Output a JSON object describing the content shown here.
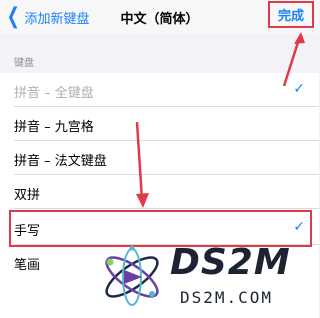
{
  "nav": {
    "back_label": "添加新键盘",
    "title": "中文（简体）",
    "done_label": "完成"
  },
  "section": {
    "header": "键盘"
  },
  "rows": [
    {
      "label": "拼音 – 全键盘",
      "checked": true,
      "disabled": true
    },
    {
      "label": "拼音 – 九宫格",
      "checked": false,
      "disabled": false
    },
    {
      "label": "拼音 – 法文键盘",
      "checked": false,
      "disabled": false
    },
    {
      "label": "双拼",
      "checked": false,
      "disabled": false
    },
    {
      "label": "手写",
      "checked": true,
      "disabled": false
    },
    {
      "label": "笔画",
      "checked": false,
      "disabled": false
    }
  ],
  "icons": {
    "back": "chevron-left-icon",
    "check": "checkmark-icon"
  },
  "colors": {
    "accent": "#1a82f6",
    "annotation": "#e03a4a"
  },
  "watermark": {
    "main": "DS2M",
    "sub": "DS2M.COM"
  }
}
